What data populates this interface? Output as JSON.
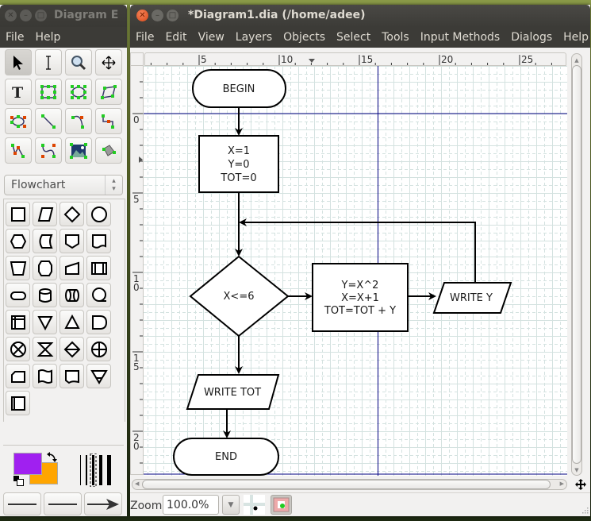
{
  "toolbox_window": {
    "title": "Diagram E",
    "menu": [
      "File",
      "Help"
    ],
    "tools": [
      {
        "name": "pointer-tool",
        "icon": "arrow-pointer-icon",
        "active": true
      },
      {
        "name": "text-edit-tool",
        "icon": "text-cursor-icon"
      },
      {
        "name": "magnify-tool",
        "icon": "magnifier-icon"
      },
      {
        "name": "scroll-tool",
        "icon": "move-arrows-icon"
      },
      {
        "name": "text-tool",
        "icon": "text-T-icon"
      },
      {
        "name": "box-tool",
        "icon": "box-icon"
      },
      {
        "name": "ellipse-tool",
        "icon": "ellipse-icon"
      },
      {
        "name": "polygon-tool",
        "icon": "polygon-icon"
      },
      {
        "name": "beziergon-tool",
        "icon": "beziergon-icon"
      },
      {
        "name": "line-tool",
        "icon": "line-icon"
      },
      {
        "name": "arc-tool",
        "icon": "arc-icon"
      },
      {
        "name": "zigzag-line-tool",
        "icon": "zigzag-line-icon"
      },
      {
        "name": "polyline-tool",
        "icon": "polyline-icon"
      },
      {
        "name": "bezier-line-tool",
        "icon": "bezier-line-icon"
      },
      {
        "name": "image-tool",
        "icon": "image-icon"
      },
      {
        "name": "outline-tool",
        "icon": "outline-icon"
      }
    ],
    "sheet_selector": "Flowchart",
    "shapes": [
      "process",
      "input-output",
      "decision",
      "connector",
      "preparation",
      "stored-data",
      "off-page-connector",
      "document",
      "manual-operation",
      "terminal-hex",
      "manual-input",
      "predefined-process",
      "terminator",
      "magnetic-disk",
      "direct-access-storage",
      "sequential-access",
      "internal-storage",
      "merge",
      "extract",
      "delay",
      "summing-junction",
      "collate",
      "sort",
      "or",
      "card",
      "punched-tape",
      "display",
      "offline-storage",
      "transaction-file"
    ],
    "colors": {
      "foreground": "#a020f0",
      "background": "#ffa500"
    },
    "line_widths": "line-width-selector",
    "arrow_styles": [
      "line-start-none",
      "line-style-solid",
      "line-end-arrow"
    ]
  },
  "main_window": {
    "title": "*Diagram1.dia (/home/adee)",
    "menu": [
      "File",
      "Edit",
      "View",
      "Layers",
      "Objects",
      "Select",
      "Tools",
      "Input Methods",
      "Dialogs",
      "Help"
    ],
    "ruler_h_labels": [
      "5",
      "10",
      "15",
      "20",
      "25"
    ],
    "ruler_v_labels": [
      "0",
      "5",
      "10",
      "15",
      "20"
    ],
    "zoom_label": "Zoom",
    "zoom_value": "100.0%",
    "diagram": {
      "begin": "BEGIN",
      "init": [
        "X=1",
        "Y=0",
        "TOT=0"
      ],
      "decision": "X<=6",
      "process": [
        "Y=X^2",
        "X=X+1",
        "TOT=TOT + Y"
      ],
      "write_y": "WRITE Y",
      "write_tot": "WRITE TOT",
      "end": "END"
    }
  }
}
